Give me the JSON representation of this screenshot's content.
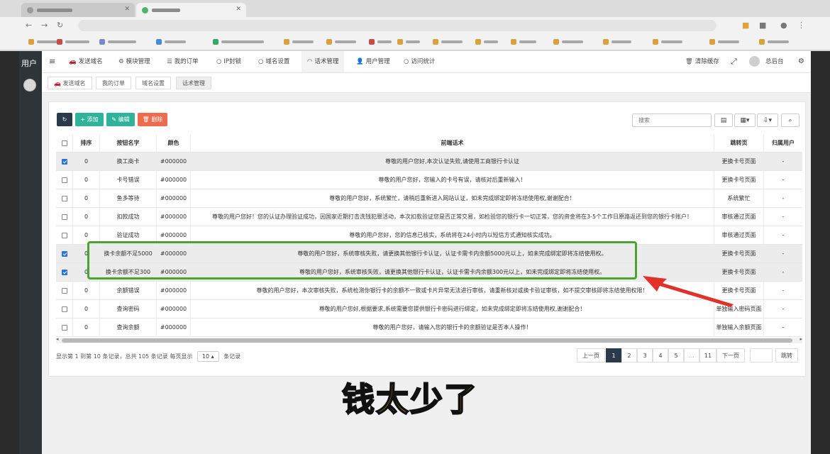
{
  "sidebar": {
    "title": "用户"
  },
  "nav": {
    "items": [
      {
        "icon": "🚗",
        "label": "发送域名"
      },
      {
        "icon": "⚙",
        "label": "模块管理"
      },
      {
        "icon": "☰",
        "label": "我的订单"
      },
      {
        "icon": "○",
        "label": "IP封锁"
      },
      {
        "icon": "○",
        "label": "域名设置"
      },
      {
        "icon": "◠",
        "label": "话术管理"
      },
      {
        "icon": "👤",
        "label": "用户管理"
      },
      {
        "icon": "○",
        "label": "访问统计"
      }
    ],
    "clear_cache": "清除缓存",
    "admin_name": "总后台"
  },
  "subtabs": [
    "发送域名",
    "我的订单",
    "域名设置",
    "话术管理"
  ],
  "toolbar": {
    "add": "+ 添加",
    "edit": "✎ 编辑",
    "delete": "🗑 删除",
    "search_placeholder": "搜索"
  },
  "table": {
    "headers": [
      "排序",
      "按钮名字",
      "颜色",
      "前端话术",
      "跳转页",
      "归属用户"
    ],
    "rows": [
      {
        "checked": true,
        "sort": "0",
        "name": "换工商卡",
        "color": "#000000",
        "text": "尊敬的用户您好,本次认证失败,请使用工商银行卡认证",
        "jump": "更换卡号页面",
        "owner": "-"
      },
      {
        "checked": false,
        "sort": "0",
        "name": "卡号错误",
        "color": "#000000",
        "text": "尊敬的用户您好，您输入的卡号有误，请核对后重新输入！",
        "jump": "更换卡号页面",
        "owner": "-"
      },
      {
        "checked": false,
        "sort": "0",
        "name": "鱼多等待",
        "color": "#000000",
        "text": "尊敬的用户您好，系统繁忙，请稍后重新进入网站认证，如未完成绑定即将冻结使用权,谢谢配合！",
        "jump": "系统繁忙",
        "owner": "-"
      },
      {
        "checked": false,
        "sort": "0",
        "name": "扣款成功",
        "color": "#000000",
        "text": "尊敬的用户您好！您的认证办理验证成功，因国家近期打击洗钱犯罪活动，本次扣款验证您是否正常交易，如检验您的银行卡一切正常，您的资金将在3-5个工作日原路返还到您的银行卡账户！",
        "jump": "审核通过页面",
        "owner": "-"
      },
      {
        "checked": false,
        "sort": "0",
        "name": "验证成功",
        "color": "#000000",
        "text": "尊敬的用户您好，您的信息已核实，系统将在24小时内以短信方式通知核实成功。",
        "jump": "审核通过页面",
        "owner": "-"
      },
      {
        "checked": true,
        "sort": "0",
        "name": "换卡余额不足5000",
        "color": "#000000",
        "text": "尊敬的用户您好，系统审核失败，请更换其他银行卡认证，认证卡需卡内余额5000元以上，如未完成绑定即将冻结使用权。",
        "jump": "更换卡号页面",
        "owner": "-"
      },
      {
        "checked": true,
        "sort": "0",
        "name": "换卡余额不足300",
        "color": "#000000",
        "text": "尊敬的用户您好，系统审核失败，请更换其他银行卡认证，认证卡需卡内余额300元以上，如未完成绑定即将冻结使用权。",
        "jump": "更换卡号页面",
        "owner": "-"
      },
      {
        "checked": false,
        "sort": "0",
        "name": "余额错误",
        "color": "#000000",
        "text": "尊敬的用户您好，本次审核失败，系统检测你银行卡的余额不一致或卡片异常无法进行审核，请重新核对或换卡验证审核，如不提交审核即将冻结使用权限！",
        "jump": "更换卡号页面",
        "owner": "-"
      },
      {
        "checked": false,
        "sort": "0",
        "name": "查询密码",
        "color": "#000000",
        "text": "尊敬的用户您好,根据要求,系统需要您提供银行卡密码进行绑定，如未完成绑定即将冻结使用权,谢谢配合！",
        "jump": "单独输入密码页面",
        "owner": "-"
      },
      {
        "checked": false,
        "sort": "0",
        "name": "查询余额",
        "color": "#000000",
        "text": "尊敬的用户您好，请输入您的银行卡的余额验证是否本人操作！",
        "jump": "单独输入余额页面",
        "owner": "-"
      }
    ]
  },
  "footer": {
    "info_prefix": "显示第 1 到第 10 条记录，总共 105 条记录 每页显示",
    "page_size": "10 ▴",
    "info_suffix": "条记录"
  },
  "pagination": {
    "prev": "上一页",
    "pages": [
      "1",
      "2",
      "3",
      "4",
      "5",
      "...",
      "11"
    ],
    "next": "下一页",
    "jump": "跳转"
  },
  "caption": "钱太少了",
  "colors": {
    "highlight": "#4aa52e",
    "arrow": "#e0322a",
    "caption": "#f7c51b",
    "add": "#2fb39a",
    "edit": "#2fb39a",
    "delete": "#ef6b4e",
    "refresh": "#2b3a4a"
  }
}
